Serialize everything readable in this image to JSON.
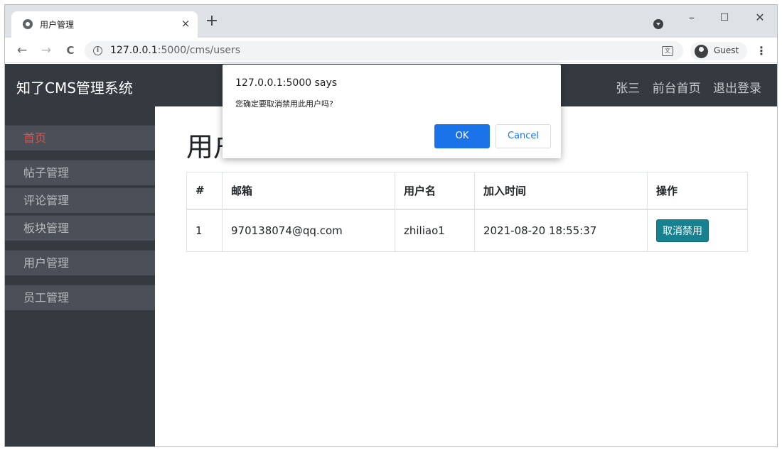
{
  "browser": {
    "tab_title": "用户管理",
    "tab_close": "×",
    "new_tab": "+",
    "url_host": "127.0.0.1",
    "url_path": ":5000/cms/users",
    "profile_name": "Guest",
    "window_minimize": "–",
    "window_maximize": "☐",
    "window_close": "✕",
    "back": "←",
    "forward": "→",
    "reload": "C",
    "menu": "⋮",
    "info": "i",
    "translate": "文"
  },
  "header": {
    "brand": "知了CMS管理系统",
    "user": "张三",
    "frontend_link": "前台首页",
    "logout": "退出登录"
  },
  "sidebar": {
    "items": [
      {
        "label": "首页",
        "active": true
      },
      {
        "label": "帖子管理"
      },
      {
        "label": "评论管理"
      },
      {
        "label": "板块管理"
      },
      {
        "label": "用户管理"
      },
      {
        "label": "员工管理"
      }
    ]
  },
  "main": {
    "heading": "用户",
    "table": {
      "headers": [
        "#",
        "邮箱",
        "用户名",
        "加入时间",
        "操作"
      ],
      "rows": [
        {
          "index": "1",
          "email": "970138074@qq.com",
          "username": "zhiliao1",
          "joined": "2021-08-20 18:55:37",
          "action": "取消禁用"
        }
      ]
    }
  },
  "dialog": {
    "origin": "127.0.0.1:5000 says",
    "message": "您确定要取消禁用此用户吗?",
    "ok": "OK",
    "cancel": "Cancel"
  },
  "colors": {
    "topbar": "#343a40",
    "active_item": "#d9534f",
    "unban_button": "#17818f",
    "dialog_ok": "#1a73e8"
  }
}
